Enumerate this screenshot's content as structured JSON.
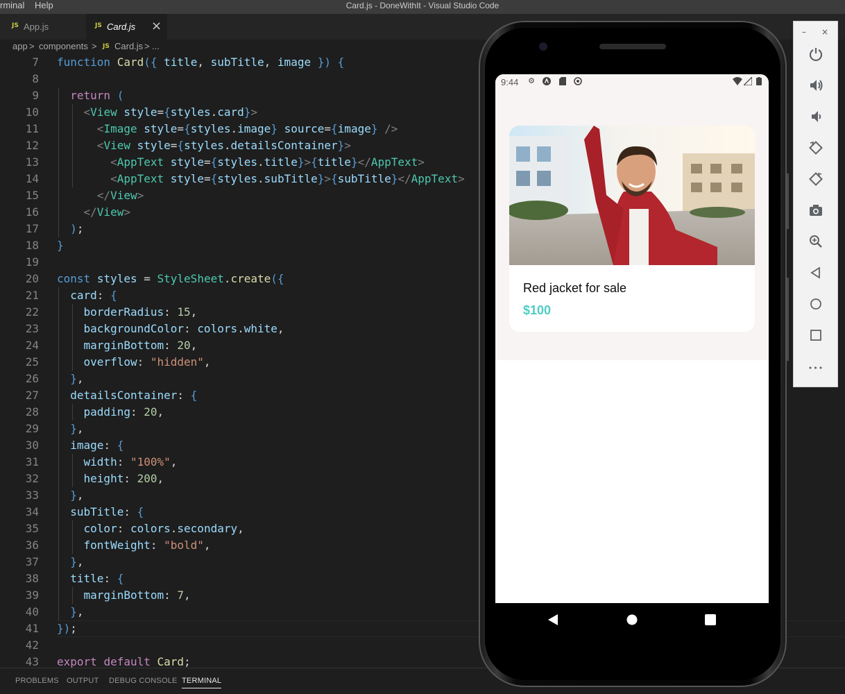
{
  "window": {
    "title": "Card.js - DoneWithIt - Visual Studio Code",
    "menu": [
      "rminal",
      "Help"
    ]
  },
  "tabs": [
    {
      "icon": "JS",
      "label": "App.js"
    },
    {
      "icon": "JS",
      "label": "Card.js",
      "close": "×"
    }
  ],
  "breadcrumb": [
    "app",
    "components",
    "JS",
    "Card.js",
    "..."
  ],
  "breadcrumb_sep": ">",
  "editor": {
    "line_numbers": [
      "7",
      "8",
      "9",
      "10",
      "11",
      "12",
      "13",
      "14",
      "15",
      "16",
      "17",
      "18",
      "19",
      "20",
      "21",
      "22",
      "23",
      "24",
      "25",
      "26",
      "27",
      "28",
      "29",
      "30",
      "31",
      "32",
      "33",
      "34",
      "35",
      "36",
      "37",
      "38",
      "39",
      "40",
      "41",
      "42",
      "43"
    ],
    "lines": [
      "function Card({ title, subTitle, image }) {",
      "",
      "  return (",
      "    <View style={styles.card}>",
      "      <Image style={styles.image} source={image} />",
      "      <View style={styles.detailsContainer}>",
      "        <AppText style={styles.title}>{title}</AppText>",
      "        <AppText style={styles.subTitle}>{subTitle}</AppText>",
      "      </View>",
      "    </View>",
      "  );",
      "}",
      "",
      "const styles = StyleSheet.create({",
      "  card: {",
      "    borderRadius: 15,",
      "    backgroundColor: colors.white,",
      "    marginBottom: 20,",
      "    overflow: \"hidden\",",
      "  },",
      "  detailsContainer: {",
      "    padding: 20,",
      "  },",
      "  image: {",
      "    width: \"100%\",",
      "    height: 200,",
      "  },",
      "  subTitle: {",
      "    color: colors.secondary,",
      "    fontWeight: \"bold\",",
      "  },",
      "  title: {",
      "    marginBottom: 7,",
      "  },",
      "});",
      "",
      "export default Card;"
    ]
  },
  "bottom_panel": {
    "tabs": [
      "PROBLEMS",
      "OUTPUT",
      "DEBUG CONSOLE",
      "TERMINAL"
    ],
    "active": "TERMINAL"
  },
  "phone": {
    "status_time": "9:44",
    "card": {
      "title": "Red jacket for sale",
      "subtitle": "$100"
    },
    "colors": {
      "secondary": "#4ecdc4",
      "app_background": "#f8f4f4",
      "card_background": "#ffffff"
    }
  },
  "emulator_toolbar": {
    "window_controls": [
      "–",
      "×"
    ],
    "buttons": [
      "power-icon",
      "volume-up-icon",
      "volume-down-icon",
      "rotate-left-icon",
      "rotate-right-icon",
      "camera-icon",
      "zoom-icon",
      "back-icon",
      "home-icon",
      "overview-icon",
      "more-icon"
    ],
    "more_glyph": "•••"
  }
}
